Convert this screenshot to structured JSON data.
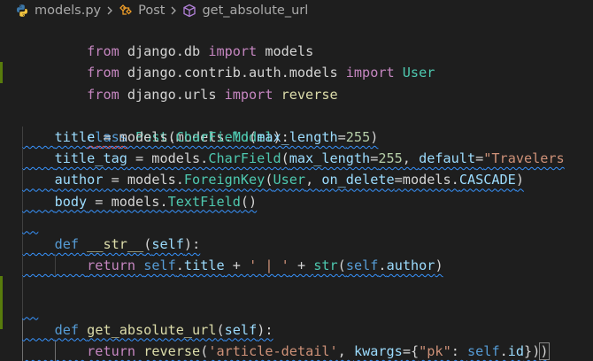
{
  "breadcrumb": {
    "file": "models.py",
    "class_name": "Post",
    "method_name": "get_absolute_url"
  },
  "icons": {
    "file_icon": "python-icon",
    "class_icon": "class-symbol-icon",
    "method_icon": "method-cube-icon",
    "separator_icon": "chevron-right-icon"
  },
  "colors": {
    "background": "#1e1e1e",
    "keyword": "#569cd6",
    "import_keyword": "#c586c0",
    "class_name": "#4ec9b0",
    "function": "#dcdcaa",
    "variable": "#9cdcfe",
    "string": "#ce9178",
    "number": "#b5cea8",
    "modified_gutter": "#587c0c",
    "warning_squiggle": "#3794ff",
    "error_squiggle": "#f14c4c"
  },
  "code": {
    "l1": {
      "t1": "from",
      "t2": " django.db ",
      "t3": "import",
      "t4": " models"
    },
    "l2": {
      "t1": "from",
      "t2": " django.contrib.auth.models ",
      "t3": "import",
      "t4": " User"
    },
    "l3": {
      "t1": "from",
      "t2": " django.urls ",
      "t3": "import",
      "t4": " reverse"
    },
    "l5": {
      "t1": "class",
      "t2": " ",
      "t3": "Post",
      "t4": "(models.",
      "t5": "Model",
      "t6": "):"
    },
    "l6": {
      "t1": "title",
      "t2": " = models.",
      "t3": "CharField",
      "t4": "(",
      "t5": "max_length",
      "t6": "=",
      "t7": "255",
      "t8": ")"
    },
    "l7": {
      "t1": "title_tag",
      "t2": " = models.",
      "t3": "CharField",
      "t4": "(",
      "t5": "max_length",
      "t6": "=",
      "t7": "255",
      "t8": ", ",
      "t9": "default",
      "t10": "=",
      "t11": "\"Travelers"
    },
    "l8": {
      "t1": "author",
      "t2": " = models.",
      "t3": "ForeignKey",
      "t4": "(",
      "t5": "User",
      "t6": ", ",
      "t7": "on_delete",
      "t8": "=models.",
      "t9": "CASCADE",
      "t10": ")"
    },
    "l9": {
      "t1": "body",
      "t2": " = models.",
      "t3": "TextField",
      "t4": "()"
    },
    "l11": {
      "t1": "def",
      "t2": " ",
      "t3": "__str__",
      "t4": "(",
      "t5": "self",
      "t6": "):"
    },
    "l12": {
      "t1": "return",
      "t2": " ",
      "t3": "self",
      "t4": ".",
      "t5": "title",
      "t6": " + ",
      "t7": "' | '",
      "t8": " + ",
      "t9": "str",
      "t10": "(",
      "t11": "self",
      "t12": ".",
      "t13": "author",
      "t14": ")"
    },
    "l14": {
      "t1": "def",
      "t2": " ",
      "t3": "get_absolute_url",
      "t4": "(",
      "t5": "self",
      "t6": "):"
    },
    "l15": {
      "t1": "return",
      "t2": " ",
      "t3": "reverse",
      "t4": "(",
      "t5": "'article-detail'",
      "t6": ", ",
      "t7": "kwargs",
      "t8": "={",
      "t9": "\"pk\"",
      "t10": ": ",
      "t11": "self",
      "t12": ".",
      "t13": "id",
      "t14": "})",
      "t15": ")"
    }
  }
}
